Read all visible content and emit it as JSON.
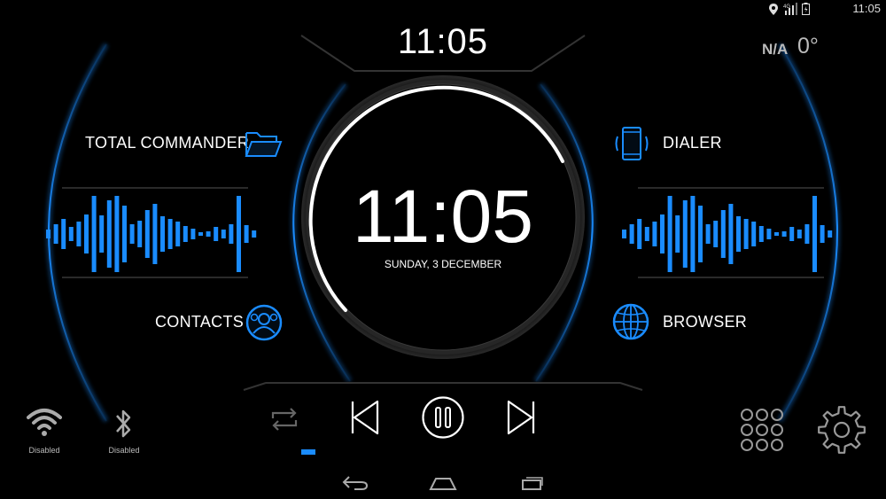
{
  "status_bar": {
    "time": "11:05",
    "network": "4G",
    "icons": [
      "location-icon",
      "signal-icon",
      "battery-icon"
    ]
  },
  "top_clock": "11:05",
  "weather": {
    "condition": "N/A",
    "temperature": "0°"
  },
  "center": {
    "time": "11:05",
    "date": "SUNDAY, 3 DECEMBER"
  },
  "shortcuts": {
    "total_commander": "TOTAL COMMANDER",
    "contacts": "CONTACTS",
    "dialer": "DIALER",
    "browser": "BROWSER"
  },
  "toggles": {
    "wifi": "Disabled",
    "bluetooth": "Disabled"
  },
  "media_controls": [
    "repeat-icon",
    "previous-icon",
    "pause-icon",
    "next-icon"
  ],
  "nav_bar": [
    "back-icon",
    "home-icon",
    "recents-icon"
  ],
  "colors": {
    "accent": "#1a8cff",
    "glow": "#1464d2",
    "text": "#ffffff",
    "muted": "#bbbbbb"
  }
}
